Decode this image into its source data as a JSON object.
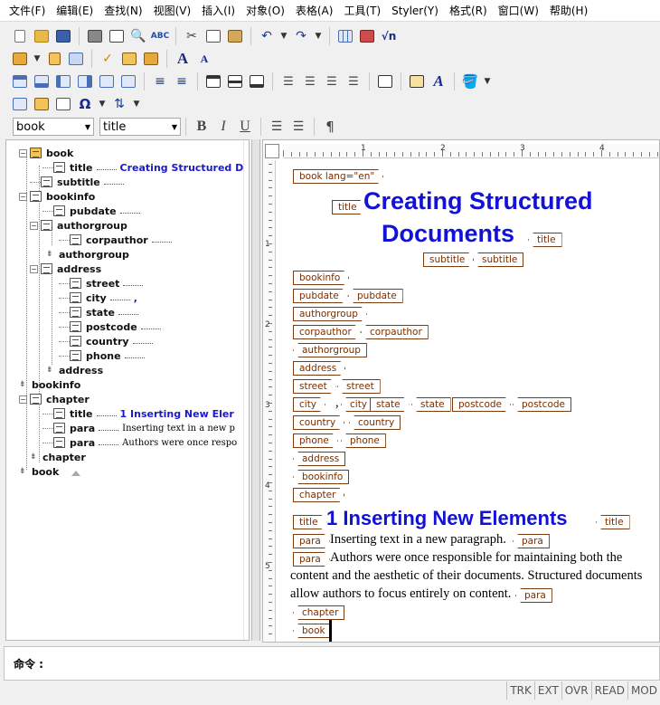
{
  "menu": [
    "文件(F)",
    "编辑(E)",
    "查找(N)",
    "视图(V)",
    "插入(I)",
    "对象(O)",
    "表格(A)",
    "工具(T)",
    "Styler(Y)",
    "格式(R)",
    "窗口(W)",
    "帮助(H)"
  ],
  "toolbar": {
    "element_combo": "book",
    "style_combo": "title",
    "bold": "B",
    "italic": "I",
    "underline": "U",
    "pilcrow": "¶",
    "omega": "Ω",
    "font_large": "A",
    "sqrt": "√n"
  },
  "icons": [
    "new-document-icon",
    "open-folder-icon",
    "save-icon",
    "print-icon",
    "print-preview-icon",
    "find-icon",
    "spellcheck-icon",
    "cut-icon",
    "copy-icon",
    "paste-icon",
    "undo-icon",
    "redo-icon",
    "table-icon",
    "image-icon",
    "equation-icon"
  ],
  "tree": {
    "nodes": [
      {
        "name": "book"
      },
      {
        "name": "title",
        "value": "Creating Structured Doc"
      },
      {
        "name": "subtitle"
      },
      {
        "name": "bookinfo"
      },
      {
        "name": "pubdate"
      },
      {
        "name": "authorgroup"
      },
      {
        "name": "corpauthor"
      },
      {
        "name": "authorgroup"
      },
      {
        "name": "address"
      },
      {
        "name": "street"
      },
      {
        "name": "city",
        "value": ","
      },
      {
        "name": "state"
      },
      {
        "name": "postcode"
      },
      {
        "name": "country"
      },
      {
        "name": "phone"
      },
      {
        "name": "address"
      },
      {
        "name": "bookinfo"
      },
      {
        "name": "chapter"
      },
      {
        "name": "title",
        "value": "1  Inserting New Eler"
      },
      {
        "name": "para",
        "value": "Inserting text in a new p"
      },
      {
        "name": "para",
        "value": "Authors were once respo"
      },
      {
        "name": "chapter"
      },
      {
        "name": "book"
      }
    ]
  },
  "ruler": {
    "numbers": [
      "1",
      "2",
      "3",
      "4"
    ],
    "vnumbers": [
      "1",
      "2",
      "3",
      "4",
      "5"
    ]
  },
  "doc": {
    "tags": {
      "book_open": "book lang=\"en\"",
      "title": "title",
      "subtitle": "subtitle",
      "bookinfo": "bookinfo",
      "pubdate": "pubdate",
      "authorgroup": "authorgroup",
      "corpauthor": "corpauthor",
      "address": "address",
      "street": "street",
      "city": "city",
      "state": "state",
      "postcode": "postcode",
      "country": "country",
      "phone": "phone",
      "chapter": "chapter",
      "para": "para",
      "book": "book"
    },
    "title_line1": "Creating Structured",
    "title_line2": "Documents",
    "city_comma": ",",
    "chapter_title": "1  Inserting New Elements",
    "para1": "Inserting text in a new paragraph.",
    "para2_line1": "Authors were once responsible for maintaining both the",
    "para2_line2": "content and the aesthetic of their documents. Structured documents",
    "para2_line3": "allow authors to focus entirely on content."
  },
  "command": {
    "label": "命令 :"
  },
  "status": [
    "TRK",
    "EXT",
    "OVR",
    "READ",
    "MOD"
  ]
}
